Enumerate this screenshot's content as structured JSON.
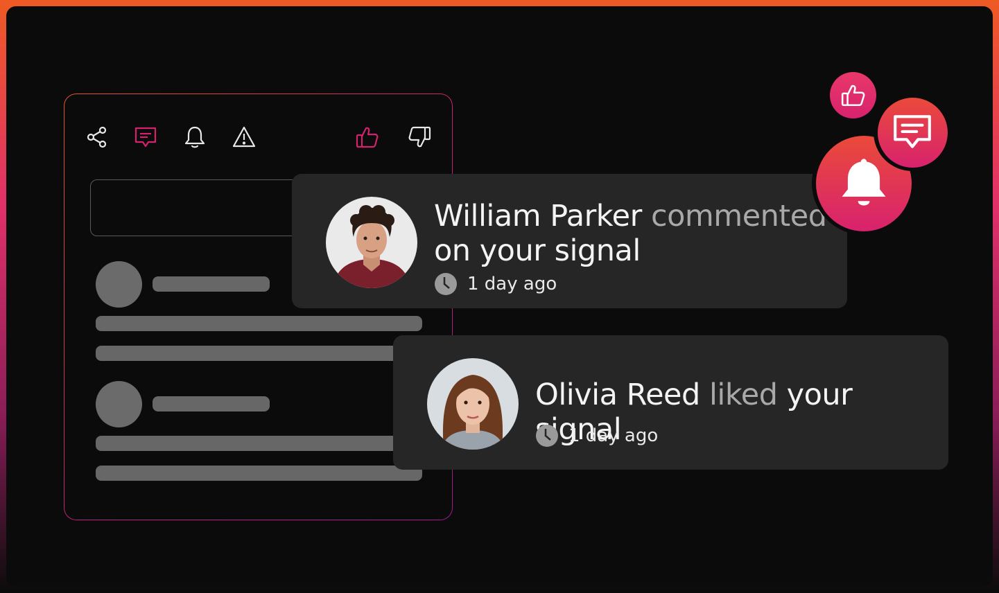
{
  "notifications": [
    {
      "actor": "William Parker",
      "verb": "commented",
      "rest": "on your signal",
      "time": "1 day ago"
    },
    {
      "actor": "Olivia Reed",
      "verb": "liked",
      "rest": "your signal",
      "time": "1 day ago"
    }
  ],
  "toolbar": {
    "icons": [
      "share-icon",
      "comment-icon",
      "bell-icon",
      "warning-icon",
      "thumbs-up-icon",
      "thumbs-down-icon"
    ],
    "active_color": "#d4226f",
    "inactive_color": "#e8e8e8"
  },
  "accent": {
    "orange": "#ee5a24",
    "pink": "#e0306a",
    "magenta": "#d4226f"
  }
}
